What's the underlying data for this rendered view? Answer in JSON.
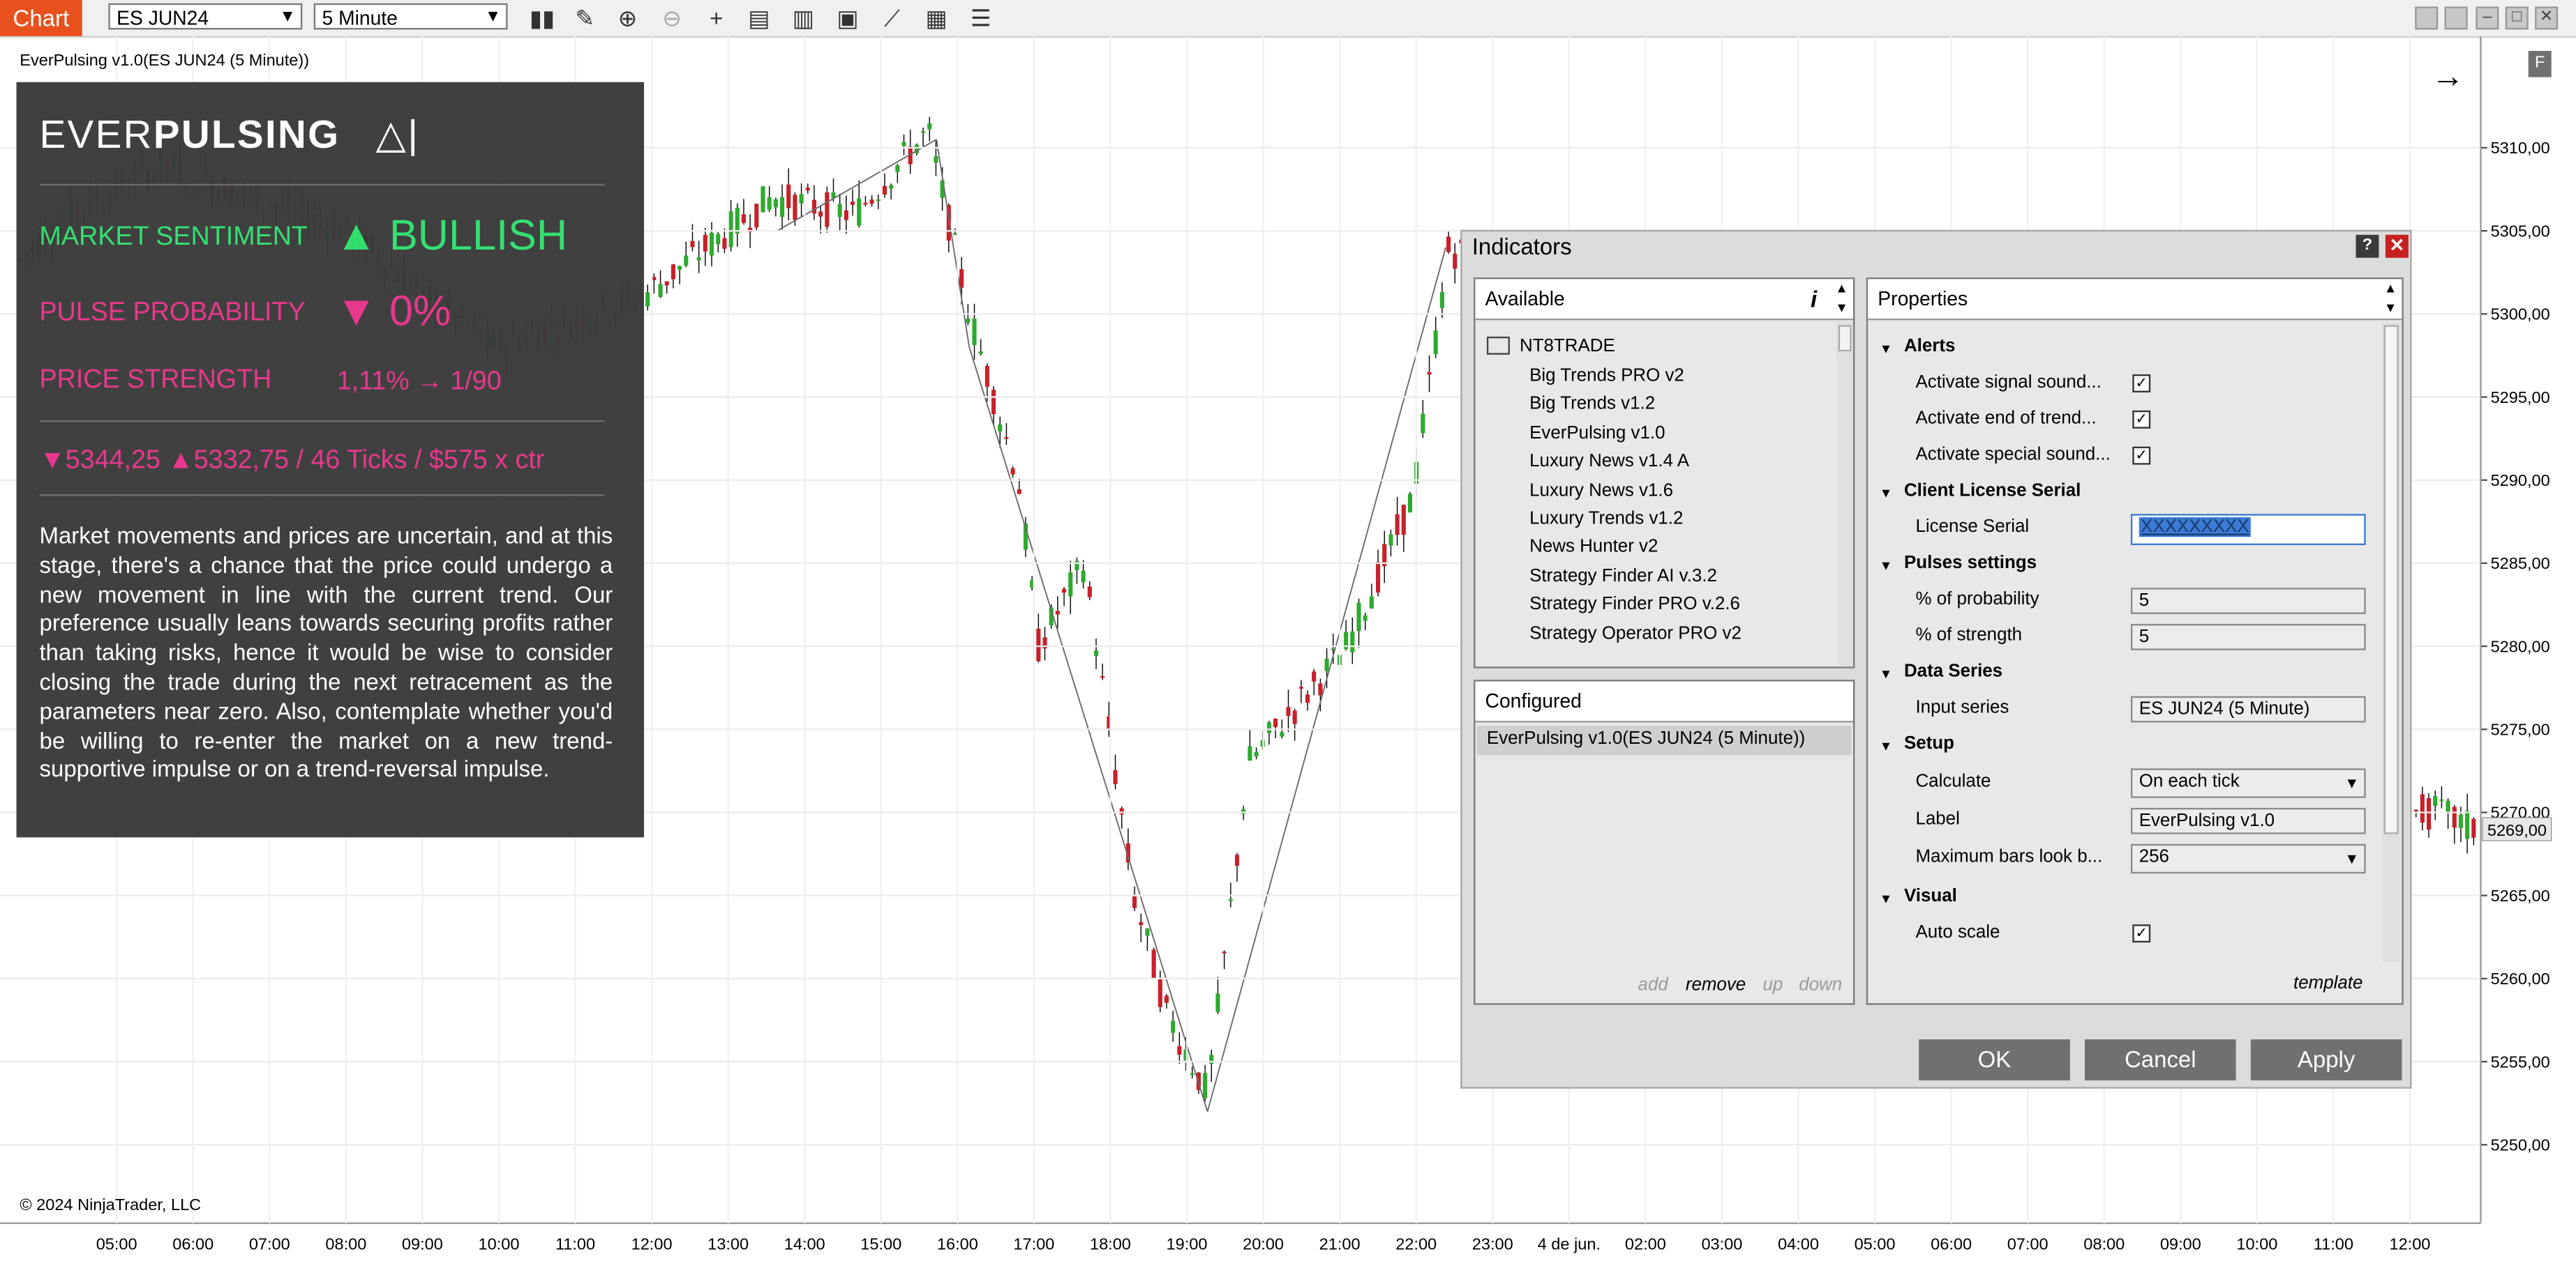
{
  "toolbar": {
    "chart_tab": "Chart",
    "instrument": "ES JUN24",
    "interval": "5 Minute",
    "icons": [
      "bars-icon",
      "pencil-icon",
      "zoom-in-icon",
      "zoom-out-icon",
      "crosshair-icon",
      "data-box-icon",
      "properties-icon",
      "strategies-icon",
      "drawing-tools-icon",
      "templates-icon",
      "menu-icon"
    ]
  },
  "chart": {
    "title": "EverPulsing v1.0(ES JUN24 (5 Minute))",
    "copyright": "© 2024 NinjaTrader, LLC",
    "f_button": "F",
    "current_price": "5269,00",
    "y_ticks": [
      "5310,00",
      "5305,00",
      "5300,00",
      "5295,00",
      "5290,00",
      "5285,00",
      "5280,00",
      "5275,00",
      "5270,00",
      "5265,00",
      "5260,00",
      "5255,00",
      "5250,00"
    ],
    "x_ticks": [
      "05:00",
      "06:00",
      "07:00",
      "08:00",
      "09:00",
      "10:00",
      "11:00",
      "12:00",
      "13:00",
      "14:00",
      "15:00",
      "16:00",
      "17:00",
      "18:00",
      "19:00",
      "20:00",
      "21:00",
      "22:00",
      "23:00",
      "4 de jun.",
      "02:00",
      "03:00",
      "04:00",
      "05:00",
      "06:00",
      "07:00",
      "08:00",
      "09:00",
      "10:00",
      "11:00",
      "12:00"
    ],
    "colors": {
      "up": "#2eaa2e",
      "down": "#c8202a",
      "wick": "#000000"
    }
  },
  "panel": {
    "logo_light": "EVER",
    "logo_bold": "PULSING",
    "logo_mark": "△|",
    "sentiment_label": "MARKET SENTIMENT",
    "sentiment_value": "▲ BULLISH",
    "probability_label": "PULSE PROBABILITY",
    "probability_value": "▼ 0%",
    "strength_label": "PRICE STRENGTH",
    "strength_value": "1,11% → 1/90",
    "levels": "▼5344,25 ▲5332,75 / 46 Ticks / $575 x ctr",
    "description": "Market movements and prices are uncertain, and at this stage, there's a chance that the price could undergo a new movement in line with the current trend. Our preference usually leans towards securing profits rather than taking risks, hence it would be wise to consider closing the trade during the next retracement as the parameters near zero. Also, contemplate whether you'd be willing to re-enter the market on a new trend-supportive impulse or on a trend-reversal impulse.",
    "colors": {
      "green": "#2fe06e",
      "pink": "#e8328a"
    }
  },
  "dialog": {
    "title": "Indicators",
    "help": "?",
    "close": "✕",
    "available_header": "Available",
    "info_icon": "i",
    "folder": "NT8TRADE",
    "available_items": [
      "Big Trends PRO v2",
      "Big Trends v1.2",
      "EverPulsing v1.0",
      "Luxury News v1.4 A",
      "Luxury News v1.6",
      "Luxury Trends v1.2",
      "News Hunter v2",
      "Strategy Finder AI v.3.2",
      "Strategy Finder PRO v.2.6",
      "Strategy Operator PRO v2"
    ],
    "configured_header": "Configured",
    "configured_items": [
      "EverPulsing v1.0(ES JUN24 (5 Minute))"
    ],
    "actions": {
      "add": "add",
      "remove": "remove",
      "up": "up",
      "down": "down"
    },
    "properties_header": "Properties",
    "sections": {
      "alerts": "Alerts",
      "license": "Client License Serial",
      "pulses": "Pulses settings",
      "data_series": "Data Series",
      "setup": "Setup",
      "visual": "Visual"
    },
    "props": {
      "signal_sound": "Activate signal sound...",
      "end_trend": "Activate end of trend...",
      "special_sound": "Activate special sound...",
      "license_serial": "License Serial",
      "license_value": "XXXXXXXXX",
      "prob": "% of probability",
      "prob_value": "5",
      "strength": "% of strength",
      "strength_value": "5",
      "input_series": "Input series",
      "input_series_value": "ES JUN24 (5 Minute)",
      "calculate": "Calculate",
      "calculate_value": "On each tick",
      "label": "Label",
      "label_value": "EverPulsing v1.0",
      "max_bars": "Maximum bars look b...",
      "max_bars_value": "256",
      "auto_scale": "Auto scale",
      "check_mark": "✓"
    },
    "template": "template",
    "ok": "OK",
    "cancel": "Cancel",
    "apply": "Apply"
  }
}
